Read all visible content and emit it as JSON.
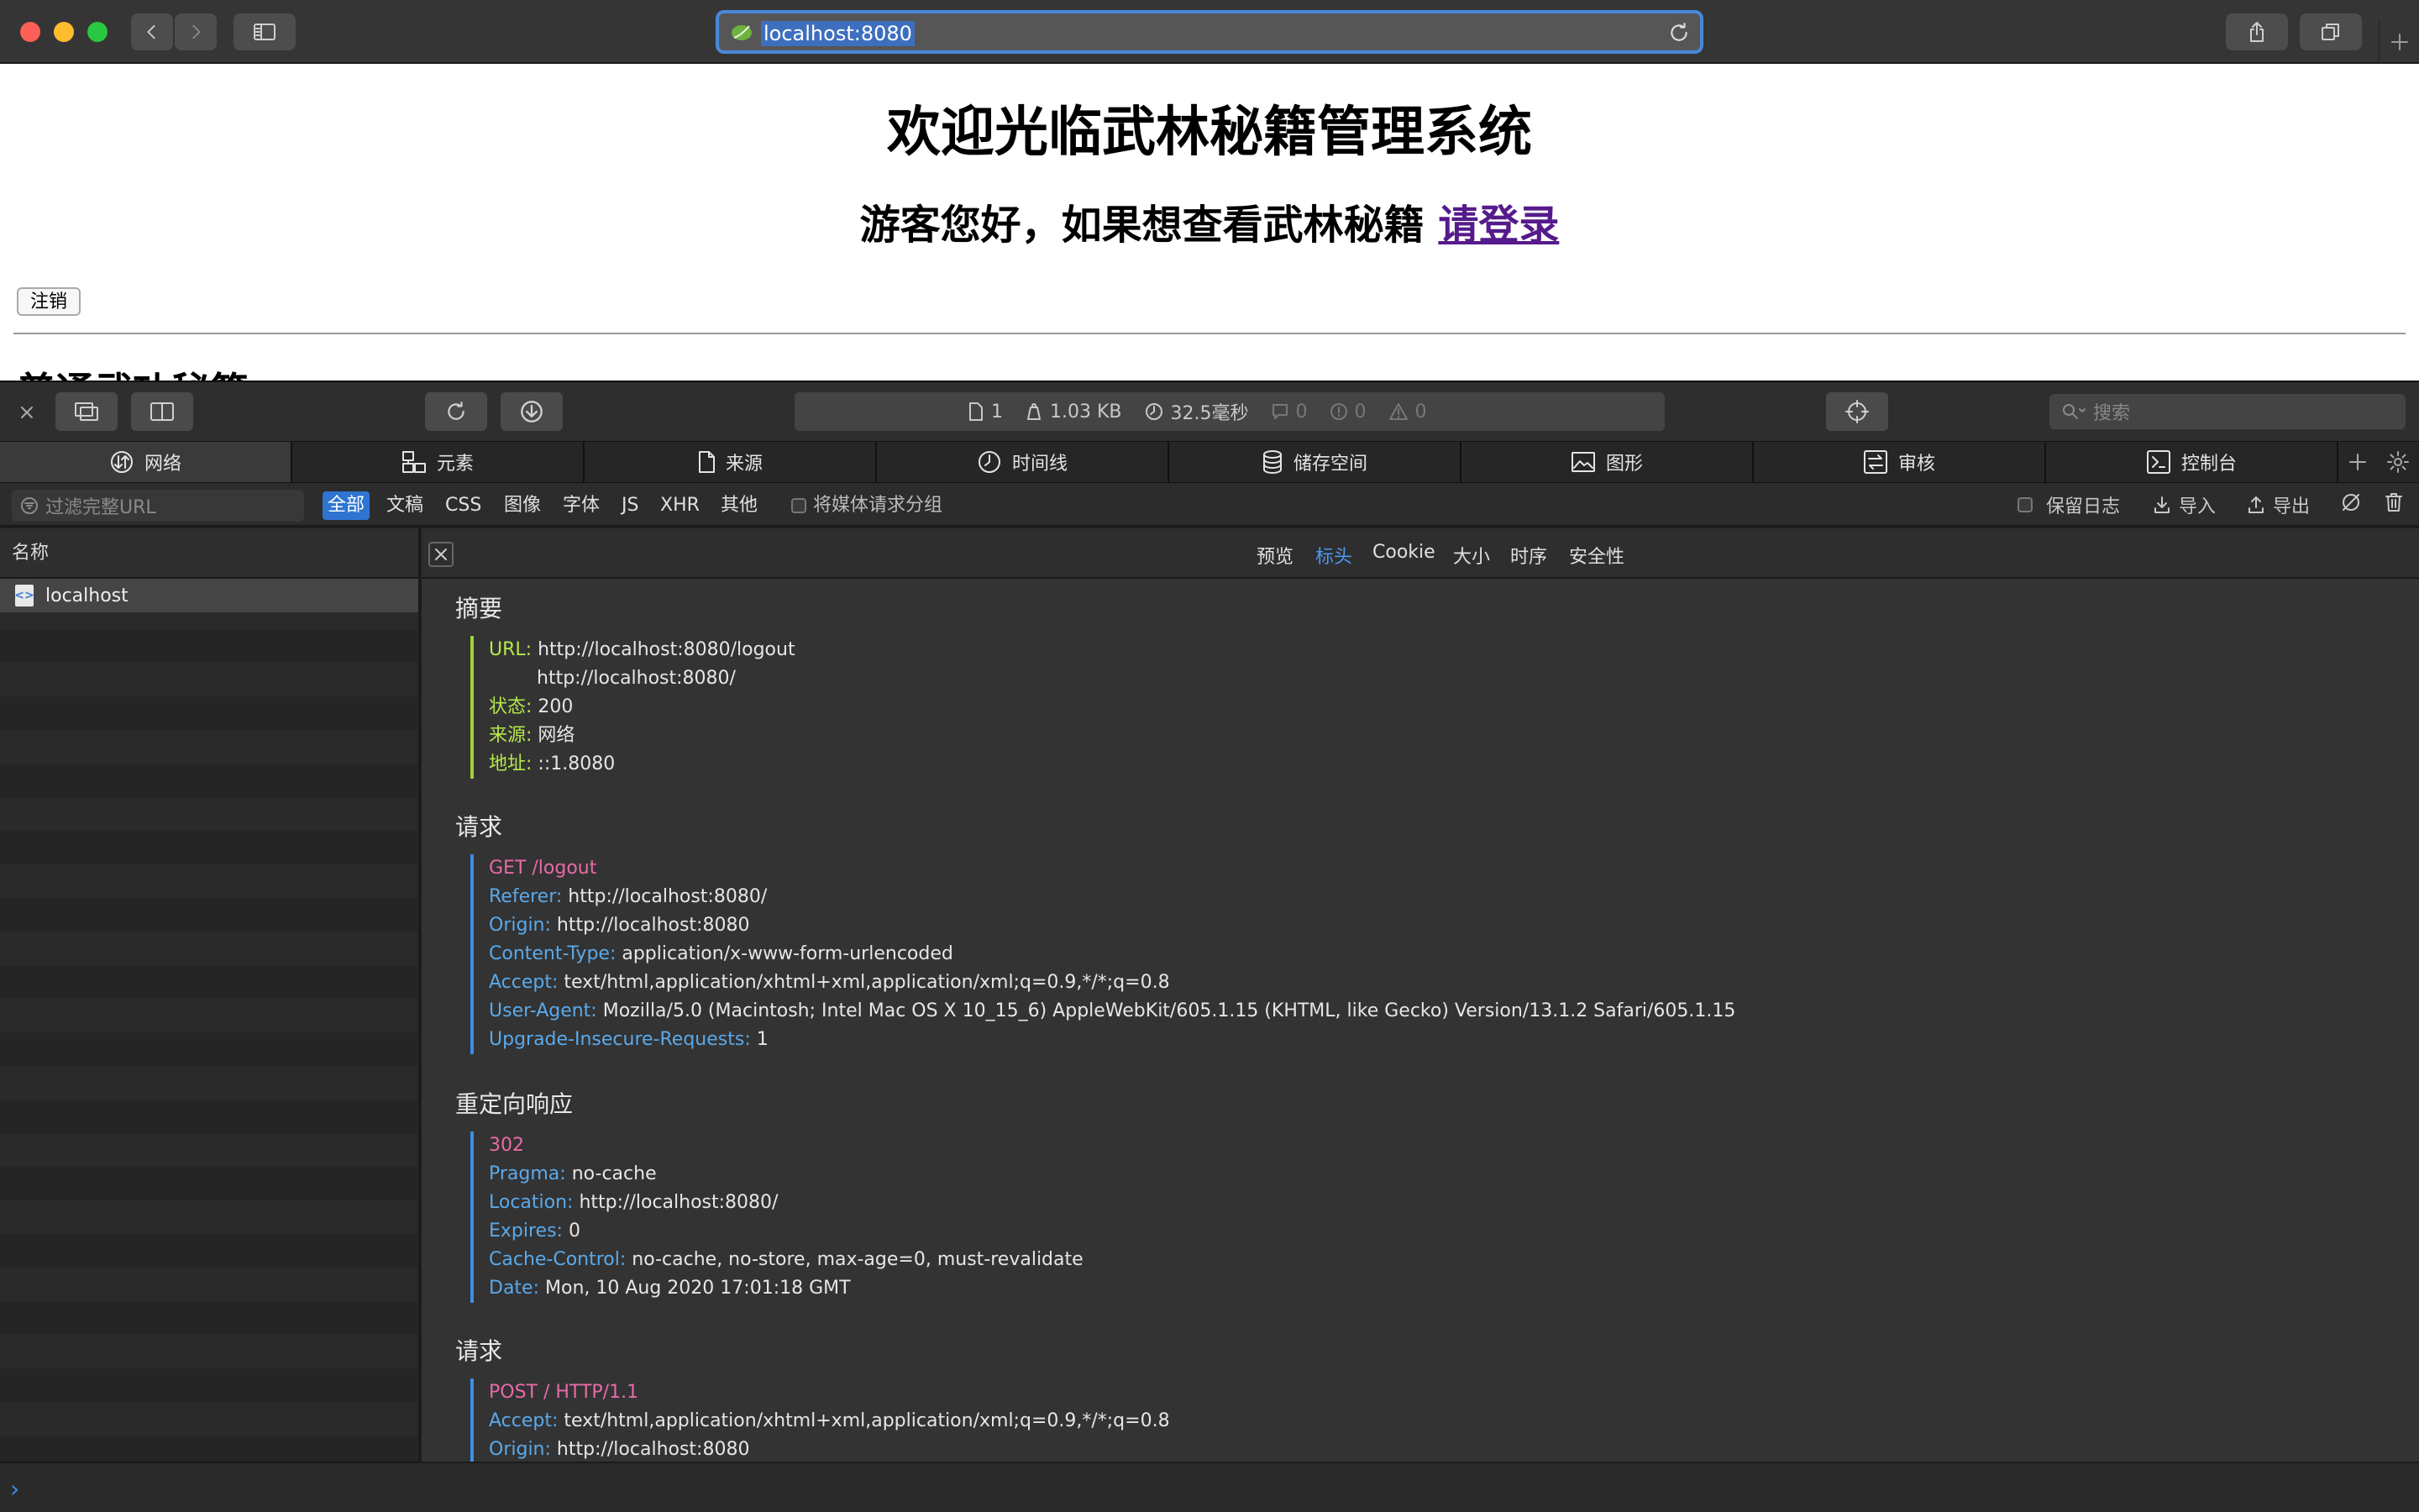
{
  "browser": {
    "url": "localhost:8080",
    "buttons": [
      "back",
      "forward",
      "sidebar",
      "share",
      "tabs-overview",
      "new-tab"
    ]
  },
  "page": {
    "title": "欢迎光临武林秘籍管理系统",
    "greeting": "游客您好，如果想查看武林秘籍",
    "login_link": "请登录",
    "logout_button": "注销",
    "clipped_heading": "普通武功秘籍"
  },
  "devtools": {
    "stats": {
      "resources": "1",
      "size": "1.03 KB",
      "time": "32.5毫秒",
      "messages": "0",
      "errors": "0",
      "warnings": "0"
    },
    "search_placeholder": "搜索",
    "tabs": [
      "网络",
      "元素",
      "来源",
      "时间线",
      "储存空间",
      "图形",
      "审核",
      "控制台"
    ],
    "filter": {
      "placeholder": "过滤完整URL",
      "types": [
        "全部",
        "文稿",
        "CSS",
        "图像",
        "字体",
        "JS",
        "XHR",
        "其他"
      ],
      "group_media": "将媒体请求分组",
      "preserve_log": "保留日志",
      "import": "导入",
      "export": "导出"
    },
    "list": {
      "header": "名称",
      "rows": [
        "localhost"
      ]
    },
    "detail_tabs": [
      "预览",
      "标头",
      "Cookie",
      "大小",
      "时序",
      "安全性"
    ],
    "sections": {
      "summary": "摘要",
      "request": "请求",
      "redirect": "重定向响应",
      "request2": "请求"
    },
    "summary": {
      "url_key": "URL:",
      "url": "http://localhost:8080/logout",
      "url2": "http://localhost:8080/",
      "status_key": "状态:",
      "status": "200",
      "source_key": "来源:",
      "source": "网络",
      "address_key": "地址:",
      "address": "::1.8080"
    },
    "request": {
      "line": "GET /logout",
      "headers": [
        {
          "k": "Referer:",
          "v": "http://localhost:8080/"
        },
        {
          "k": "Origin:",
          "v": "http://localhost:8080"
        },
        {
          "k": "Content-Type:",
          "v": "application/x-www-form-urlencoded"
        },
        {
          "k": "Accept:",
          "v": "text/html,application/xhtml+xml,application/xml;q=0.9,*/*;q=0.8"
        },
        {
          "k": "User-Agent:",
          "v": "Mozilla/5.0 (Macintosh; Intel Mac OS X 10_15_6) AppleWebKit/605.1.15 (KHTML, like Gecko) Version/13.1.2 Safari/605.1.15"
        },
        {
          "k": "Upgrade-Insecure-Requests:",
          "v": "1"
        }
      ]
    },
    "redirect": {
      "line": "302",
      "headers": [
        {
          "k": "Pragma:",
          "v": "no-cache"
        },
        {
          "k": "Location:",
          "v": "http://localhost:8080/"
        },
        {
          "k": "Expires:",
          "v": "0"
        },
        {
          "k": "Cache-Control:",
          "v": "no-cache, no-store, max-age=0, must-revalidate"
        },
        {
          "k": "Date:",
          "v": "Mon, 10 Aug 2020 17:01:18 GMT"
        }
      ]
    },
    "request2": {
      "line": "POST / HTTP/1.1",
      "headers": [
        {
          "k": "Accept:",
          "v": "text/html,application/xhtml+xml,application/xml;q=0.9,*/*;q=0.8"
        },
        {
          "k": "Origin:",
          "v": "http://localhost:8080"
        }
      ]
    },
    "console_prompt": "›"
  },
  "colors": {
    "accent": "#2f74d0",
    "summary_key": "#b6e84a",
    "header_key": "#5aa9ea",
    "request_line": "#e86aa6"
  }
}
